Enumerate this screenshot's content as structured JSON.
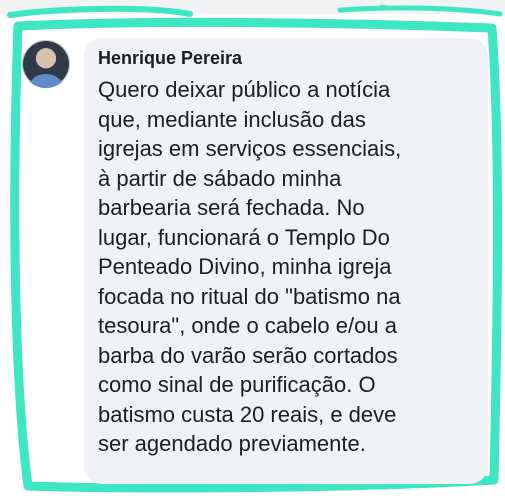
{
  "comment": {
    "author": "Henrique Pereira",
    "lines": [
      "Quero deixar público a notícia",
      "que, mediante inclusão das",
      "igrejas em serviços essenciais,",
      "à partir de sábado minha",
      "barbearia será fechada. No",
      "lugar, funcionará o Templo Do",
      "Penteado Divino, minha igreja",
      "focada no ritual do \"batismo na",
      "tesoura\", onde o cabelo e/ou a",
      "barba do varão serão cortados",
      "como sinal de purificação. O",
      "batismo custa 20 reais, e deve",
      "ser agendado previamente."
    ]
  },
  "colors": {
    "highlight": "#3ee6c4",
    "bubble": "#f0f2f5",
    "text": "#1c1e21"
  }
}
